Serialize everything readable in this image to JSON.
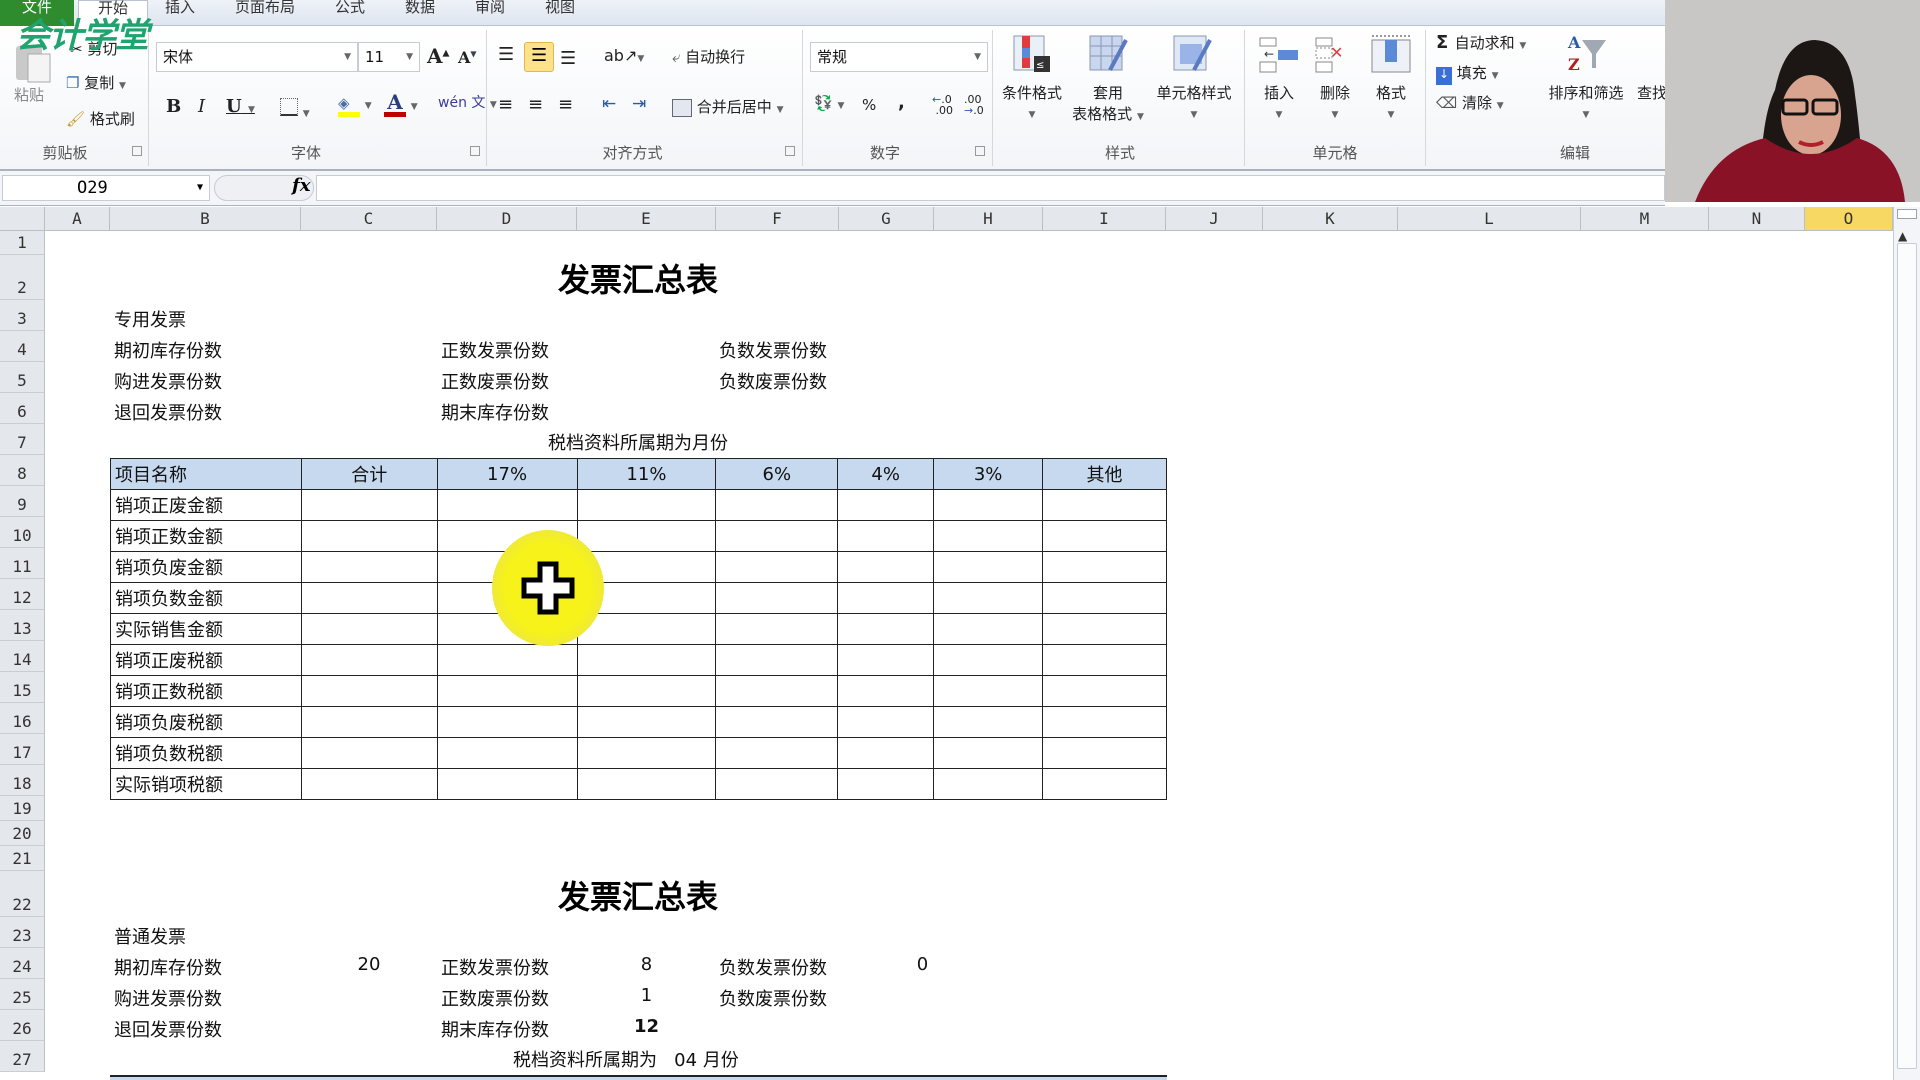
{
  "logo": "会计学堂",
  "tabs": [
    "文件",
    "开始",
    "插入",
    "页面布局",
    "公式",
    "数据",
    "审阅",
    "视图"
  ],
  "active_tab": "开始",
  "ribbon": {
    "clipboard": {
      "paste": "粘贴",
      "cut": "剪切",
      "copy": "复制",
      "format_painter": "格式刷",
      "label": "剪贴板"
    },
    "font": {
      "name": "宋体",
      "size": "11",
      "grow": "A",
      "shrink": "A",
      "bold": "B",
      "italic": "I",
      "underline": "U",
      "font_color_glyph": "A",
      "phonetic": "wén 文",
      "label": "字体"
    },
    "alignment": {
      "wrap_text": "自动换行",
      "merge_center": "合并后居中",
      "label": "对齐方式"
    },
    "number": {
      "format": "常规",
      "percent": "%",
      "comma": ",",
      "inc_decimal": ".00",
      "dec_decimal": ".0",
      "label": "数字"
    },
    "styles": {
      "conditional": "条件格式",
      "table_format_1": "套用",
      "table_format_2": "表格格式",
      "cell_styles": "单元格样式",
      "label": "样式"
    },
    "cells": {
      "insert": "插入",
      "delete": "删除",
      "format": "格式",
      "label": "单元格"
    },
    "editing": {
      "autosum": "自动求和",
      "fill": "填充",
      "clear": "清除",
      "sort_filter": "排序和筛选",
      "find": "查找",
      "label": "编辑"
    }
  },
  "formula_bar": {
    "name_box": "O29",
    "fx": "fx",
    "formula": ""
  },
  "columns": [
    "A",
    "B",
    "C",
    "D",
    "E",
    "F",
    "G",
    "H",
    "I",
    "J",
    "K",
    "L",
    "M",
    "N",
    "O"
  ],
  "selected_column": "O",
  "rows": [
    "1",
    "2",
    "3",
    "4",
    "5",
    "6",
    "7",
    "8",
    "9",
    "10",
    "11",
    "12",
    "13",
    "14",
    "15",
    "16",
    "17",
    "18",
    "19",
    "20",
    "21",
    "22",
    "23",
    "24",
    "25",
    "26",
    "27"
  ],
  "sheet": {
    "section1": {
      "title": "发票汇总表",
      "type": "专用发票",
      "labels": {
        "opening_stock": "期初库存份数",
        "purchased": "购进发票份数",
        "returned": "退回发票份数",
        "positive_issued": "正数发票份数",
        "positive_void": "正数废票份数",
        "closing_stock": "期末库存份数",
        "negative_issued": "负数发票份数",
        "negative_void": "负数废票份数"
      },
      "period": "税档资料所属期为月份",
      "table": {
        "headers": [
          "项目名称",
          "合计",
          "17%",
          "11%",
          "6%",
          "4%",
          "3%",
          "其他"
        ],
        "rows": [
          [
            "销项正废金额",
            "",
            "",
            "",
            "",
            "",
            "",
            ""
          ],
          [
            "销项正数金额",
            "",
            "",
            "",
            "",
            "",
            "",
            ""
          ],
          [
            "销项负废金额",
            "",
            "",
            "",
            "",
            "",
            "",
            ""
          ],
          [
            "销项负数金额",
            "",
            "",
            "",
            "",
            "",
            "",
            ""
          ],
          [
            "实际销售金额",
            "",
            "",
            "",
            "",
            "",
            "",
            ""
          ],
          [
            "销项正废税额",
            "",
            "",
            "",
            "",
            "",
            "",
            ""
          ],
          [
            "销项正数税额",
            "",
            "",
            "",
            "",
            "",
            "",
            ""
          ],
          [
            "销项负废税额",
            "",
            "",
            "",
            "",
            "",
            "",
            ""
          ],
          [
            "销项负数税额",
            "",
            "",
            "",
            "",
            "",
            "",
            ""
          ],
          [
            "实际销项税额",
            "",
            "",
            "",
            "",
            "",
            "",
            ""
          ]
        ]
      }
    },
    "section2": {
      "title": "发票汇总表",
      "type": "普通发票",
      "labels": {
        "opening_stock": "期初库存份数",
        "purchased": "购进发票份数",
        "returned": "退回发票份数",
        "positive_issued": "正数发票份数",
        "positive_void": "正数废票份数",
        "closing_stock": "期末库存份数",
        "negative_issued": "负数发票份数",
        "negative_void": "负数废票份数"
      },
      "values": {
        "opening_stock": "20",
        "positive_issued": "8",
        "positive_void": "1",
        "closing_stock": "12",
        "negative_issued": "0"
      },
      "period_prefix": "税档资料所属期为",
      "period_month": "04",
      "period_suffix": "月份"
    }
  },
  "colors": {
    "accent_file_tab": "#2e8b2e",
    "header_fill": "#c6d9ef",
    "selected_col": "#f7d862",
    "logo": "#1fa36f",
    "cursor_halo": "#f6f21a"
  }
}
